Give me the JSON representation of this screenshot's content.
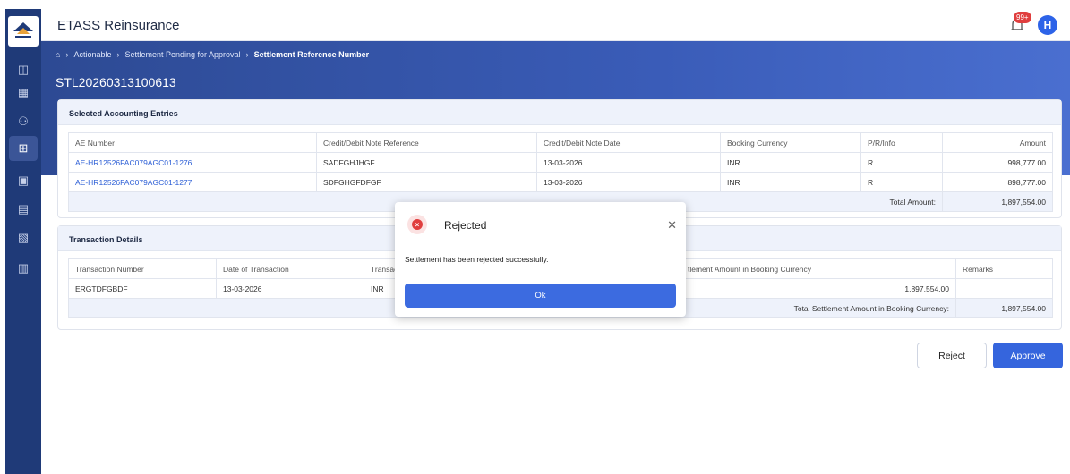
{
  "app": {
    "title": "ETASS Reinsurance",
    "notification_count": "99+",
    "avatar_initial": "H"
  },
  "sidebar": {
    "icons": [
      "grid-icon",
      "dashboard-icon",
      "users-icon",
      "entry-icon",
      "document-icon",
      "file-icon",
      "note-icon",
      "report-icon"
    ]
  },
  "breadcrumb": {
    "items": [
      "Actionable",
      "Settlement Pending for Approval",
      "Settlement Reference Number"
    ]
  },
  "page": {
    "title": "STL20260313100613"
  },
  "accounting": {
    "heading": "Selected Accounting Entries",
    "columns": [
      "AE Number",
      "Credit/Debit Note Reference",
      "Credit/Debit Note Date",
      "Booking Currency",
      "P/R/Info",
      "Amount"
    ],
    "rows": [
      {
        "ae": "AE-HR12526FAC079AGC01-1276",
        "ref": "SADFGHJHGF",
        "date": "13-03-2026",
        "currency": "INR",
        "pri": "R",
        "amount": "998,777.00"
      },
      {
        "ae": "AE-HR12526FAC079AGC01-1277",
        "ref": "SDFGHGFDFGF",
        "date": "13-03-2026",
        "currency": "INR",
        "pri": "R",
        "amount": "898,777.00"
      }
    ],
    "total_label": "Total Amount:",
    "total_value": "1,897,554.00"
  },
  "transactions": {
    "heading": "Transaction Details",
    "columns": [
      "Transaction Number",
      "Date of Transaction",
      "Transact",
      "tlement Amount in Booking Currency",
      "Remarks"
    ],
    "rows": [
      {
        "number": "ERGTDFGBDF",
        "date": "13-03-2026",
        "currency": "INR",
        "amount": "1,897,554.00",
        "remarks": ""
      }
    ],
    "total_label": "Total Settlement Amount in Booking Currency:",
    "total_value": "1,897,554.00"
  },
  "modal": {
    "title": "Rejected",
    "message": "Settlement has been rejected successfully.",
    "ok_label": "Ok"
  },
  "actions": {
    "reject_label": "Reject",
    "approve_label": "Approve"
  }
}
